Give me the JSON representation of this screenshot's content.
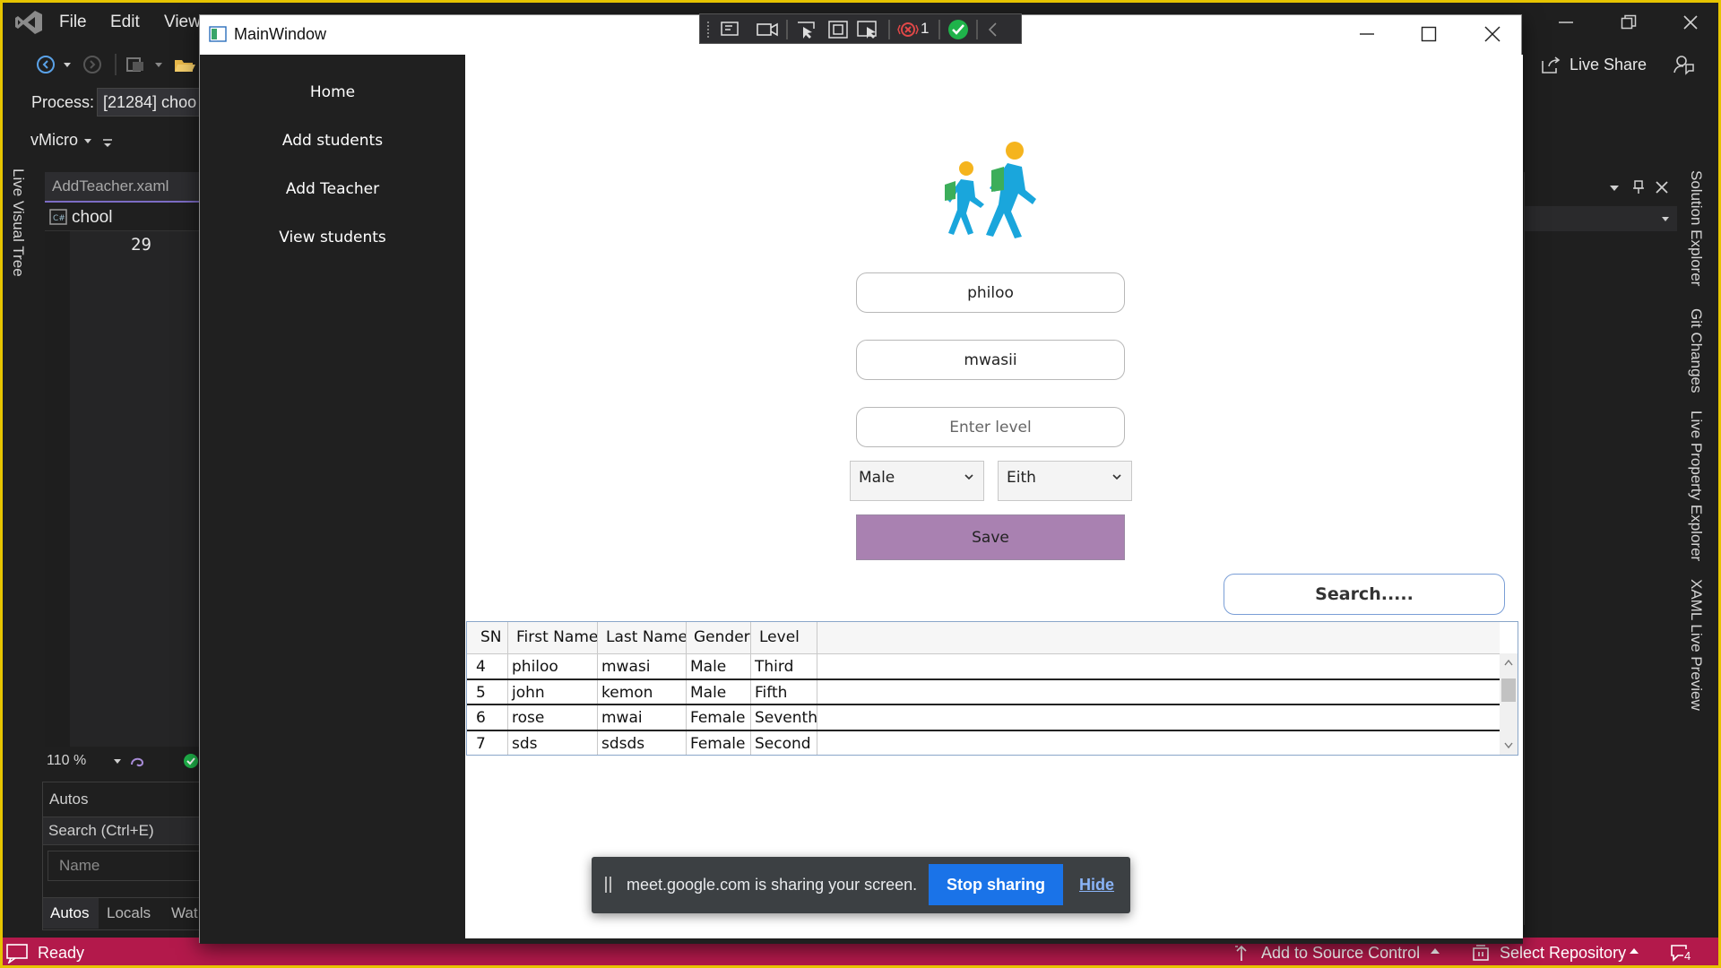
{
  "vs": {
    "menu": [
      "File",
      "Edit",
      "View"
    ],
    "process_label": "Process:",
    "process_value": "[21284] choo",
    "vmicro_label": "vMicro",
    "live_visual_tree": "Live Visual Tree",
    "editor_tab": "AddTeacher.xaml",
    "editor_nav_label": "chool",
    "line_number": "29",
    "zoom": "110 %",
    "autos_title": "Autos",
    "autos_search": "Search (Ctrl+E)",
    "autos_col_name": "Name",
    "autos_tabs": [
      "Autos",
      "Locals",
      "Wat"
    ],
    "live_share": "Live Share",
    "right_tabs": [
      "Solution Explorer",
      "Git Changes",
      "Live Property Explorer",
      "XAML Live Preview"
    ],
    "status_ready": "Ready",
    "add_to_source_control": "Add to Source Control",
    "select_repository": "Select Repository",
    "notifications_count": "4",
    "accent": "#b3194b",
    "frame_color": "#e6c400"
  },
  "debug_toolbar": {
    "binding_failures": "1"
  },
  "window": {
    "title": "MainWindow"
  },
  "nav": {
    "items": [
      {
        "label": "Home"
      },
      {
        "label": "Add students"
      },
      {
        "label": "Add Teacher"
      },
      {
        "label": "View students"
      }
    ]
  },
  "form": {
    "first_name_value": "philoo",
    "last_name_value": "mwasii",
    "level_placeholder": "Enter level",
    "gender_selected": "Male",
    "level_selected": "Eith",
    "save_label": "Save",
    "save_color": "#a981b1",
    "search_text": "Search....."
  },
  "grid": {
    "columns": [
      "SN",
      "First Name",
      "Last Name",
      "Gender",
      "Level"
    ],
    "rows": [
      [
        "4",
        "philoo",
        "mwasi",
        "Male",
        "Third"
      ],
      [
        "5",
        "john",
        "kemon",
        "Male",
        "Fifth"
      ],
      [
        "6",
        "rose",
        "mwai",
        "Female",
        "Seventh"
      ],
      [
        "7",
        "sds",
        "sdsds",
        "Female",
        "Second"
      ]
    ]
  },
  "share_notice": {
    "message": "meet.google.com is sharing your screen.",
    "stop_label": "Stop sharing",
    "hide_label": "Hide",
    "stop_color": "#1a73e8"
  }
}
